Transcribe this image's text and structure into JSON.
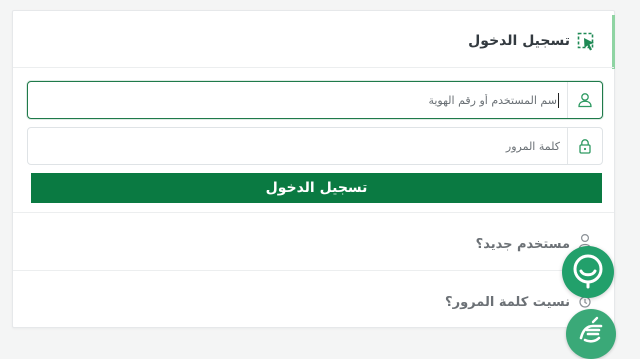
{
  "login": {
    "title": "تسجيل الدخول",
    "username_placeholder": "اسم المستخدم أو رقم الهوية",
    "password_placeholder": "كلمة المرور",
    "submit_label": "تسجيل الدخول"
  },
  "links": {
    "new_user": "مستخدم جديد؟",
    "forgot_password": "نسيت كلمة المرور؟"
  },
  "icons": {
    "header": "cursor-click-icon",
    "username": "user-icon",
    "password": "lock-icon",
    "new_user": "user-plus-icon",
    "forgot_password": "key-icon",
    "chat": "chat-support-icon",
    "accessibility": "sign-language-icon"
  },
  "colors": {
    "primary": "#0a7a42",
    "accent": "#8fd4a3",
    "chat": "#22a06b"
  }
}
